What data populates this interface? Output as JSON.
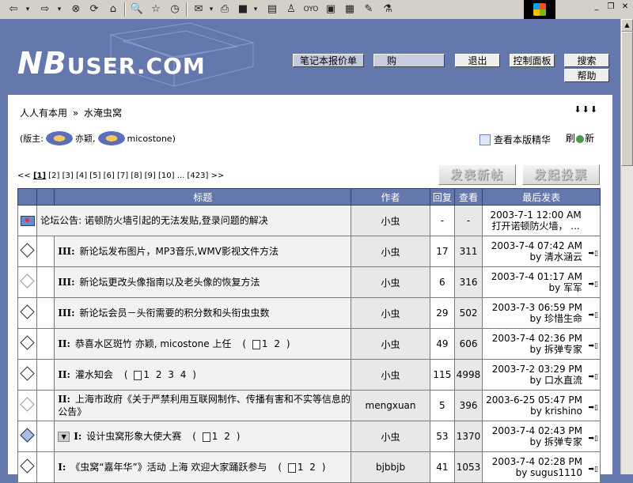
{
  "toolbar": {
    "back_icon": "back-arrow-icon",
    "forward_icon": "forward-arrow-icon"
  },
  "header": {
    "logo_text": "NBUSER.COM",
    "logo_nb": "NB",
    "logo_rest": "USER.COM",
    "quote_link": "笔记本报价单",
    "search_value": "购",
    "exit": "退出",
    "control_panel": "控制面板",
    "search": "搜索",
    "help": "帮助"
  },
  "breadcrumb": {
    "home": "人人有本用",
    "separator": "»",
    "forum": "水淹虫窝",
    "expand": "⬇⬇⬇"
  },
  "moderators": {
    "prefix": "(版主:",
    "names": [
      "亦颖,",
      "micostone)"
    ]
  },
  "essence_label": "查看本版精华",
  "refresh_label_a": "刷",
  "refresh_label_b": "新",
  "pagination": {
    "prev": "<<",
    "current": "[1]",
    "pages": "[2] [3] [4] [5] [6] [7] [8] [9] [10]",
    "ellipsis": "...",
    "last": "[423]",
    "next": ">>"
  },
  "buttons": {
    "post_new": "发表新帖",
    "post_poll": "发起投票"
  },
  "table": {
    "headers": {
      "title": "标题",
      "author": "作者",
      "replies": "回复",
      "views": "查看",
      "last_post": "最后发表"
    },
    "rows": [
      {
        "icon": "announcement-icon",
        "prefix": "",
        "title": "论坛公告: 诺顿防火墙引起的无法发贴,登录问题的解决",
        "pages": "",
        "author": "小虫",
        "replies": "-",
        "views": "-",
        "last_time": "2003-7-1 12:00 AM",
        "last_by": "打开诺顿防火墙， ..."
      },
      {
        "icon": "diamond",
        "prefix": "III:",
        "title": "新论坛发布图片，MP3音乐,WMV影视文件方法",
        "pages": "",
        "author": "小虫",
        "replies": "17",
        "views": "311",
        "last_time": "2003-7-4 07:42 AM",
        "last_by": "by 清水涵云"
      },
      {
        "icon": "diamond-gray",
        "prefix": "III:",
        "title": "新论坛更改头像指南以及老头像的恢复方法",
        "pages": "",
        "author": "小虫",
        "replies": "6",
        "views": "316",
        "last_time": "2003-7-4 01:17 AM",
        "last_by": "by 军军"
      },
      {
        "icon": "diamond",
        "prefix": "III:",
        "title": "新论坛会员－头衔需要的积分数和头衔虫虫数",
        "pages": "",
        "author": "小虫",
        "replies": "29",
        "views": "502",
        "last_time": "2003-7-3 06:59 PM",
        "last_by": "by 珍惜生命"
      },
      {
        "icon": "diamond",
        "prefix": "II:",
        "title": "恭喜水区斑竹 亦颖, micostone 上任",
        "pages": "1 2",
        "author": "小虫",
        "replies": "49",
        "views": "606",
        "last_time": "2003-7-4 02:36 PM",
        "last_by": "by 拆弹专家"
      },
      {
        "icon": "diamond",
        "prefix": "II:",
        "title": "灌水知会",
        "pages": "1 2 3 4",
        "author": "小虫",
        "replies": "115",
        "views": "4998",
        "last_time": "2003-7-2 03:29 PM",
        "last_by": "by 口水直流"
      },
      {
        "icon": "diamond-gray",
        "prefix": "II:",
        "title": "上海市政府《关于严禁利用互联网制作、传播有害和不实等信息的公告》",
        "pages": "",
        "author": "mengxuan",
        "replies": "5",
        "views": "396",
        "last_time": "2003-6-25 05:47 PM",
        "last_by": "by krishino"
      },
      {
        "icon": "diamond-blue",
        "prefix": "I:",
        "title": "设计虫窝形象大使大赛",
        "pages": "1 2",
        "author": "小虫",
        "replies": "53",
        "views": "1370",
        "last_time": "2003-7-4 02:43 PM",
        "last_by": "by 拆弹专家",
        "vote": true
      },
      {
        "icon": "diamond",
        "prefix": "I:",
        "title": "《虫窝“嘉年华”》活动 上海 欢迎大家踊跃参与",
        "pages": "1 2",
        "author": "bjbbjb",
        "replies": "41",
        "views": "1053",
        "last_time": "2003-7-4 02:28 PM",
        "last_by": "by sugus1110"
      }
    ]
  },
  "colors": {
    "header_bg": "#6578ad",
    "table_head": "#6578ad"
  }
}
